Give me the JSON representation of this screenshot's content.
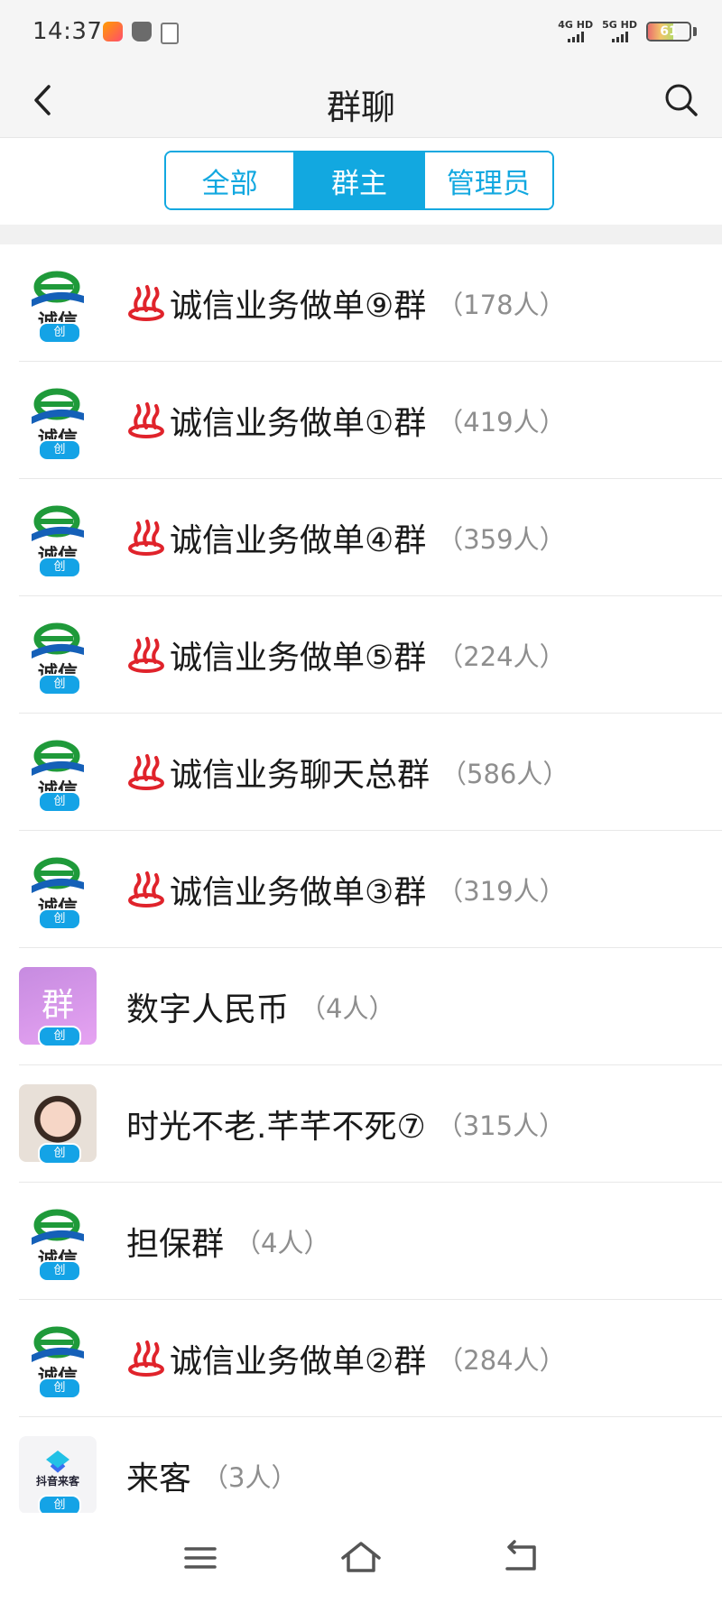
{
  "status_bar": {
    "time": "14:37",
    "net1": "4G HD",
    "net2": "5G HD",
    "battery": "61",
    "battery_level": 0.61
  },
  "header": {
    "title": "群聊",
    "back_icon": "chevron-left-icon",
    "search_icon": "search-icon"
  },
  "tabs": [
    {
      "label": "全部",
      "active": false
    },
    {
      "label": "群主",
      "active": true
    },
    {
      "label": "管理员",
      "active": false
    }
  ],
  "colors": {
    "accent": "#12a8e0",
    "badge": "#14a3e6",
    "fire": "#e0232b",
    "logo_green": "#1f9a3a",
    "logo_blue": "#1560b8"
  },
  "avatar_logo_text": "诚信",
  "avatar_purple_text": "群",
  "douyin_logo_text": "抖音来客",
  "creator_badge": "创",
  "groups": [
    {
      "name": "诚信业务做单⑨群",
      "count": "（178人）",
      "fire": true,
      "avatar": "logo"
    },
    {
      "name": "诚信业务做单①群",
      "count": "（419人）",
      "fire": true,
      "avatar": "logo"
    },
    {
      "name": "诚信业务做单④群",
      "count": "（359人）",
      "fire": true,
      "avatar": "logo"
    },
    {
      "name": "诚信业务做单⑤群",
      "count": "（224人）",
      "fire": true,
      "avatar": "logo"
    },
    {
      "name": "诚信业务聊天总群",
      "count": "（586人）",
      "fire": true,
      "avatar": "logo"
    },
    {
      "name": "诚信业务做单③群",
      "count": "（319人）",
      "fire": true,
      "avatar": "logo"
    },
    {
      "name": "数字人民币",
      "count": "（4人）",
      "fire": false,
      "avatar": "purple"
    },
    {
      "name": "时光不老.芊芊不死⑦",
      "count": "（315人）",
      "fire": false,
      "avatar": "photo"
    },
    {
      "name": "担保群",
      "count": "（4人）",
      "fire": false,
      "avatar": "logo"
    },
    {
      "name": "诚信业务做单②群",
      "count": "（284人）",
      "fire": true,
      "avatar": "logo"
    },
    {
      "name": "来客",
      "count": "（3人）",
      "fire": false,
      "avatar": "douyin"
    }
  ],
  "nav": {
    "menu_icon": "menu-icon",
    "home_icon": "home-icon",
    "back_icon": "back-icon"
  }
}
